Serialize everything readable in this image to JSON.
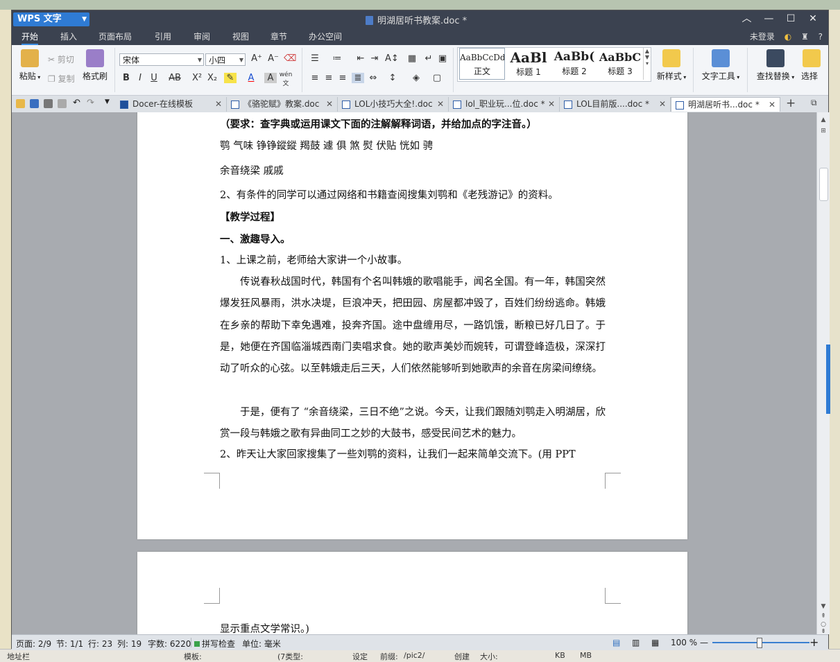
{
  "window": {
    "app_button": "WPS 文字",
    "doc_title": "明湖居听书教案.doc *"
  },
  "menu": {
    "items": [
      "开始",
      "插入",
      "页面布局",
      "引用",
      "审阅",
      "视图",
      "章节",
      "办公空间"
    ],
    "active": "开始",
    "login": "未登录",
    "help": "?"
  },
  "ribbon": {
    "paste": "粘贴",
    "cut": "剪切",
    "copy": "复制",
    "format_painter": "格式刷",
    "font_name": "宋体",
    "font_size": "小四",
    "styles": [
      {
        "sample": "AaBbCcDd",
        "name": "正文"
      },
      {
        "sample": "AaBl",
        "name": "标题 1"
      },
      {
        "sample": "AaBb(",
        "name": "标题 2"
      },
      {
        "sample": "AaBbC",
        "name": "标题 3"
      }
    ],
    "new_style": "新样式",
    "text_tools": "文字工具",
    "find_replace": "查找替换",
    "select": "选择"
  },
  "tabs": [
    {
      "label": "Docer-在线模板",
      "active": false
    },
    {
      "label": "《骆驼赋》教案.doc",
      "active": false
    },
    {
      "label": "LOL小技巧大全!.doc",
      "active": false
    },
    {
      "label": "lol_职业玩...位.doc *",
      "active": false
    },
    {
      "label": "LOL目前版....doc *",
      "active": false
    },
    {
      "label": "明湖居听书...doc *",
      "active": true
    }
  ],
  "document": {
    "requirement": "（要求：查字典或运用课文下面的注解解释词语，并给加点的字注音。）",
    "vocab1": "鹗   气味   铮铮鏦鏦   羯鼓   遽   俱   煞   熨   伏贴   恍如   骋",
    "vocab2": "余音绕梁   戚戚",
    "item2": "2、有条件的同学可以通过网络和书籍查阅搜集刘鹗和《老残游记》的资料。",
    "process_heading": "【教学过程】",
    "section1": "一、激趣导入。",
    "story_intro": "1、上课之前，老师给大家讲一个小故事。",
    "story_p1": "传说春秋战国时代，韩国有个名叫韩娥的歌唱能手，闻名全国。有一年，韩国突然爆发狂风暴雨，洪水决堤，巨浪冲天，把田园、房屋都冲毁了，百姓们纷纷逃命。韩娥在乡亲的帮助下幸免遇难，投奔齐国。途中盘缠用尽，一路饥饿，断粮已好几日了。于是，她便在齐国临淄城西南门卖唱求食。她的歌声美妙而婉转，可谓登峰造极，深深打动了听众的心弦。以至韩娥走后三天，人们依然能够听到她歌声的余音在房梁间缭绕。",
    "story_p2": "于是，便有了 “余音绕梁，三日不绝”之说。今天，让我们跟随刘鹗走入明湖居，欣赏一段与韩娥之歌有异曲同工之妙的大鼓书，感受民间艺术的魅力。",
    "item2b": "2、昨天让大家回家搜集了一些刘鹗的资料，让我们一起来简单交流下。(用 PPT",
    "page2_line": "显示重点文学常识。)"
  },
  "status": {
    "page": "页面: 2/9",
    "section": "节: 1/1",
    "row": "行: 23",
    "col": "列: 19",
    "words": "字数: 6220",
    "spell": "拼写检查",
    "unit": "单位: 毫米",
    "zoom": "100 %"
  },
  "background_bottom": {
    "a": "地址栏",
    "b": "模板:",
    "c": "(7类型:",
    "d": "设定",
    "e": "前缀:",
    "f": "/pic2/",
    "g": "创建",
    "h": "大小:",
    "i": "KB",
    "j": "MB"
  }
}
